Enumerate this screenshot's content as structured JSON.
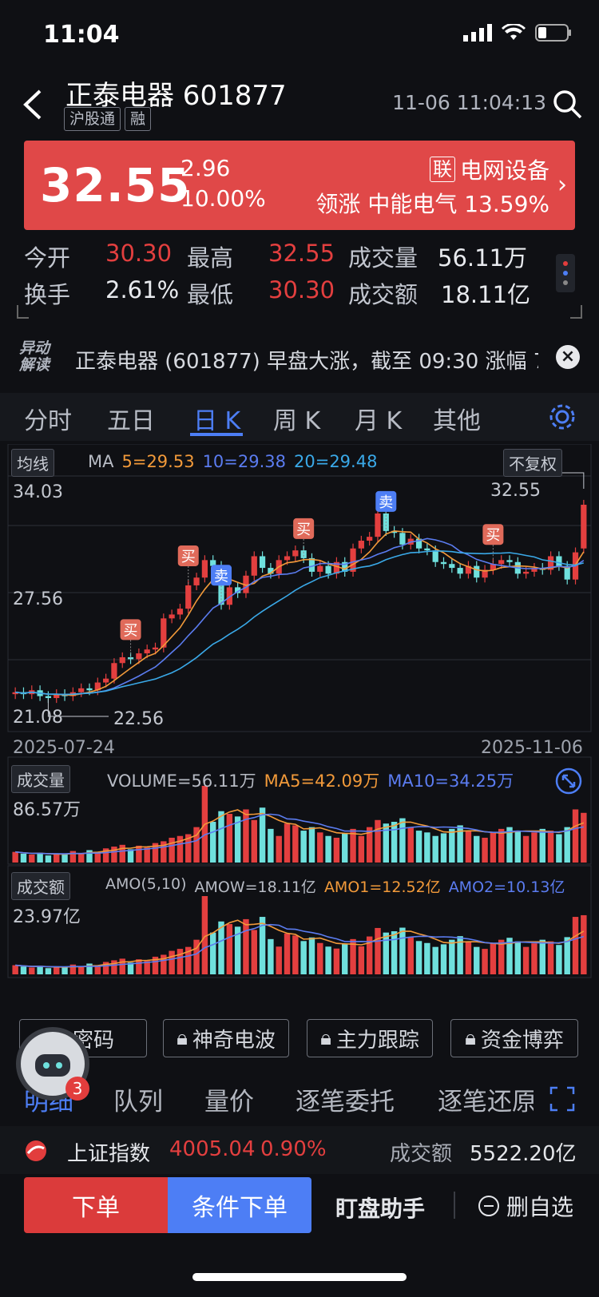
{
  "status": {
    "time": "11:04"
  },
  "header": {
    "title": "正泰电器 601877",
    "tags": [
      "沪股通",
      "融"
    ],
    "datetime": "11-06 11:04:13"
  },
  "quote": {
    "price": "32.55",
    "change": "2.96",
    "change_pct": "10.00%",
    "lian_badge": "联",
    "sector": "电网设备",
    "lead_label": "领涨",
    "lead_stock": "中能电气",
    "lead_pct": "13.59%"
  },
  "stats": {
    "open_label": "今开",
    "open": "30.30",
    "high_label": "最高",
    "high": "32.55",
    "vol_label": "成交量",
    "vol": "56.11万",
    "turnover_label": "换手",
    "turnover": "2.61%",
    "low_label": "最低",
    "low": "30.30",
    "amount_label": "成交额",
    "amount": "18.11亿"
  },
  "news": {
    "logo_line1": "异动",
    "logo_line2": "解读",
    "text": "正泰电器 (601877) 早盘大涨，截至 09:30 涨幅 7..."
  },
  "tabs": [
    "分时",
    "五日",
    "日 K",
    "周 K",
    "月 K",
    "其他"
  ],
  "kline": {
    "ma_selector": "均线",
    "ma_label": "MA",
    "ma5": "5=29.53",
    "ma10": "10=29.38",
    "ma20": "20=29.48",
    "adj_selector": "不复权",
    "y_top": "34.03",
    "y_mid": "27.56",
    "y_low": "21.08",
    "low_marker": "22.56",
    "high_marker": "32.55",
    "date_start": "2025-07-24",
    "date_end": "2025-11-06",
    "signal_buy": "买",
    "signal_sell": "卖"
  },
  "volume": {
    "selector": "成交量",
    "label": "VOLUME=56.11万",
    "ma5": "MA5=42.09万",
    "ma10": "MA10=34.25万",
    "y_top": "86.57万"
  },
  "amount": {
    "selector": "成交额",
    "title": "AMO(5,10)",
    "label": "AMOW=18.11亿",
    "amo1": "AMO1=12.52亿",
    "amo2": "AMO2=10.13亿",
    "y_top": "23.97亿"
  },
  "feature_buttons": [
    "力密码",
    "神奇电波",
    "主力跟踪",
    "资金博弈"
  ],
  "detail_tabs": [
    "明细",
    "队列",
    "量价",
    "逐笔委托",
    "逐笔还原"
  ],
  "index_bar": {
    "name": "上证指数",
    "value": "4005.04",
    "pct": "0.90%",
    "amount_label": "成交额",
    "amount": "5522.20亿"
  },
  "actions": {
    "order": "下单",
    "cond_order": "条件下单",
    "assistant": "盯盘助手",
    "remove_watch": "删自选"
  },
  "badge_count": "3",
  "colors": {
    "up": "#e33f3f",
    "down": "#6fe0dd",
    "accent": "#4d7ef5",
    "ma5": "#f29a3a",
    "ma10": "#5b7cf0",
    "ma20": "#3aa9e8"
  },
  "chart_data": [
    {
      "type": "candlestick",
      "title": "日K",
      "x_start": "2025-07-24",
      "x_end": "2025-11-06",
      "ylim": [
        21.08,
        34.03
      ],
      "markers": {
        "low": 22.56,
        "high": 32.55
      },
      "closes": [
        22.9,
        22.8,
        23.0,
        22.7,
        22.6,
        22.8,
        22.7,
        22.9,
        23.1,
        23.0,
        23.4,
        23.6,
        24.4,
        24.7,
        24.6,
        24.9,
        25.1,
        25.2,
        26.7,
        26.9,
        27.2,
        28.4,
        28.8,
        29.7,
        29.4,
        27.4,
        28.3,
        28.0,
        28.9,
        29.9,
        29.3,
        29.0,
        29.7,
        29.9,
        30.2,
        29.8,
        29.1,
        29.4,
        29.0,
        29.6,
        29.1,
        30.3,
        30.7,
        30.9,
        32.1,
        31.2,
        31.1,
        30.5,
        30.8,
        30.3,
        30.2,
        29.6,
        29.5,
        29.3,
        29.0,
        29.4,
        28.8,
        29.2,
        29.5,
        29.7,
        29.6,
        29.0,
        29.1,
        29.3,
        29.2,
        29.9,
        29.4,
        28.7,
        30.1,
        32.55
      ],
      "signals": [
        {
          "type": "买",
          "index": 14
        },
        {
          "type": "买",
          "index": 21
        },
        {
          "type": "卖",
          "index": 25
        },
        {
          "type": "买",
          "index": 35
        },
        {
          "type": "卖",
          "index": 45
        },
        {
          "type": "买",
          "index": 58
        }
      ]
    },
    {
      "type": "bar",
      "title": "成交量",
      "ylim": [
        0,
        86.57
      ],
      "unit": "万",
      "values": [
        12,
        10,
        9,
        11,
        8,
        10,
        9,
        13,
        10,
        14,
        12,
        16,
        18,
        20,
        15,
        19,
        17,
        22,
        24,
        28,
        30,
        32,
        40,
        86.57,
        46,
        58,
        55,
        52,
        60,
        48,
        62,
        38,
        30,
        44,
        42,
        36,
        40,
        34,
        30,
        28,
        33,
        38,
        30,
        40,
        48,
        44,
        46,
        50,
        40,
        36,
        34,
        30,
        33,
        38,
        42,
        36,
        30,
        28,
        34,
        38,
        40,
        36,
        30,
        34,
        38,
        36,
        32,
        40,
        60,
        56.11
      ]
    },
    {
      "type": "bar",
      "title": "成交额",
      "ylim": [
        0,
        23.97
      ],
      "unit": "亿",
      "values": [
        2.8,
        2.4,
        2.1,
        2.6,
        1.9,
        2.3,
        2.1,
        3.0,
        2.3,
        3.3,
        2.8,
        3.8,
        4.3,
        4.8,
        3.6,
        4.6,
        4.1,
        5.4,
        6.0,
        7.2,
        7.8,
        8.4,
        10.6,
        23.97,
        12.8,
        16.2,
        15.4,
        14.6,
        16.9,
        13.6,
        17.6,
        10.8,
        8.5,
        12.5,
        11.9,
        10.2,
        11.3,
        9.6,
        8.5,
        7.9,
        9.4,
        10.8,
        8.6,
        11.6,
        14.2,
        12.8,
        13.2,
        14.3,
        11.4,
        10.2,
        9.6,
        8.4,
        9.2,
        10.6,
        11.7,
        10.0,
        8.4,
        7.8,
        9.5,
        10.6,
        11.2,
        10.1,
        8.4,
        9.5,
        10.6,
        10.1,
        9.0,
        11.4,
        17.6,
        18.11
      ]
    }
  ]
}
